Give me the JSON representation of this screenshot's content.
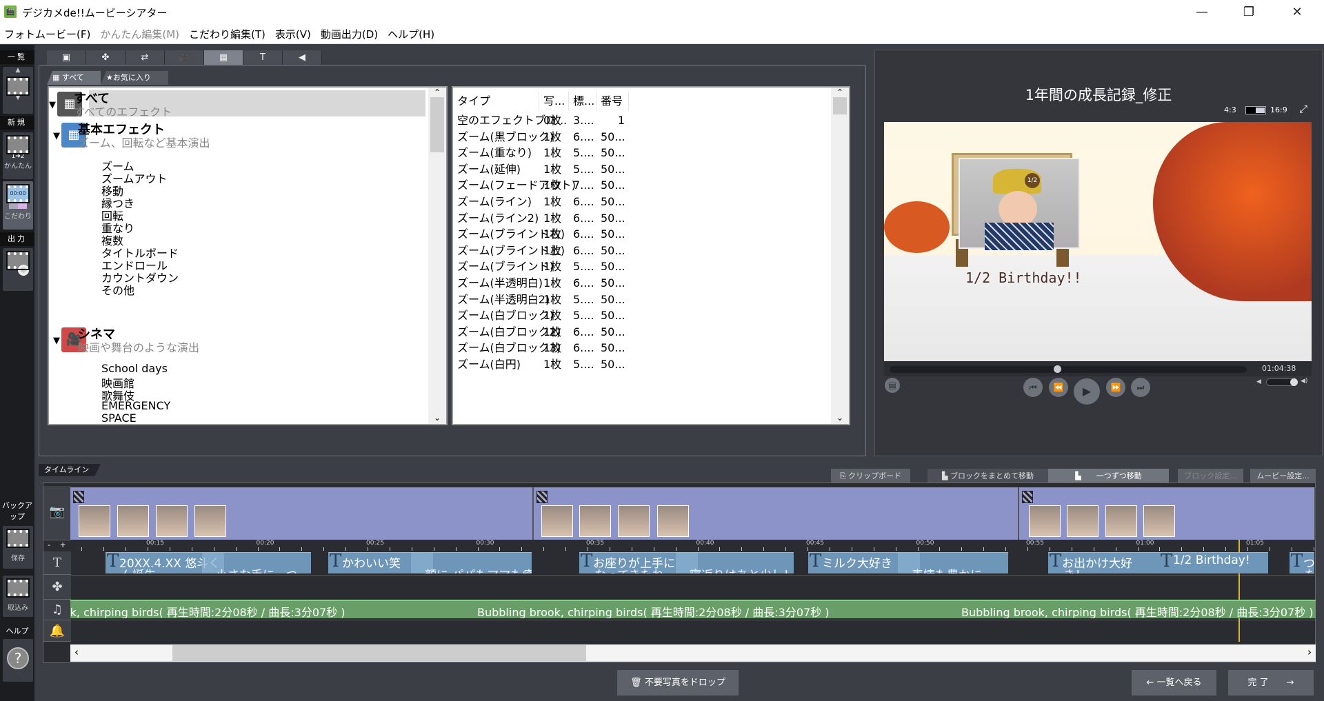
{
  "window": {
    "title": "デジカメde!!ムービーシアター",
    "minimize": "—",
    "restore": "❐",
    "close": "✕"
  },
  "menu": [
    {
      "label": "フォトムービー(F)",
      "disabled": false
    },
    {
      "label": "かんたん編集(M)",
      "disabled": true
    },
    {
      "label": "こだわり編集(T)",
      "disabled": false
    },
    {
      "label": "表示(V)",
      "disabled": false
    },
    {
      "label": "動画出力(D)",
      "disabled": false
    },
    {
      "label": "ヘルプ(H)",
      "disabled": false
    }
  ],
  "sidebar": {
    "list": "一覧",
    "new": "新規",
    "easy": "かんたん",
    "easy_badge": "1➜2",
    "detail": "こだわり",
    "detail_time": "00:00",
    "output": "出力",
    "backup": "バックアップ",
    "save": "保存",
    "import": "取込み",
    "help": "ヘルプ",
    "help_icon": "?"
  },
  "icon_tabs": [
    {
      "icon": "photo-frame-icon",
      "glyph": "▣"
    },
    {
      "icon": "clover-icon",
      "glyph": "✤"
    },
    {
      "icon": "transition-icon",
      "glyph": "⇄"
    },
    {
      "icon": "camera-icon",
      "glyph": "🎥"
    },
    {
      "icon": "effect-grid-icon",
      "glyph": "▦",
      "active": true
    },
    {
      "icon": "text-icon",
      "glyph": "T"
    },
    {
      "icon": "sound-icon",
      "glyph": "◀"
    }
  ],
  "sub_tabs": {
    "all": "すべて",
    "favorites": "★お気に入り"
  },
  "tree": {
    "categories": [
      {
        "name": "すべて",
        "desc": "すべてのエフェクト",
        "color": "#555555",
        "glyph": "▦",
        "children": []
      },
      {
        "name": "基本エフェクト",
        "desc": "ズーム、回転など基本演出",
        "color": "#4a86c8",
        "glyph": "▦",
        "children": [
          "ズーム",
          "ズームアウト",
          "移動",
          "縁つき",
          "回転",
          "重なり",
          "複数",
          "タイトルボード",
          "エンドロール",
          "カウントダウン",
          "その他"
        ]
      },
      {
        "name": "シネマ",
        "desc": "映画や舞台のような演出",
        "color": "#d04848",
        "glyph": "🎥",
        "children": [
          "School days",
          "映画館",
          "歌舞伎",
          "EMERGENCY",
          "SPACE"
        ]
      }
    ]
  },
  "table": {
    "headers": [
      "タイプ",
      "写...",
      "標...",
      "番号"
    ],
    "rows": [
      [
        "空のエフェクトブロ...",
        "0枚",
        "3....",
        "1"
      ],
      [
        "ズーム(黒ブロック)",
        "1枚",
        "6....",
        "50..."
      ],
      [
        "ズーム(重なり)",
        "1枚",
        "5....",
        "50..."
      ],
      [
        "ズーム(延伸)",
        "1枚",
        "5....",
        "50..."
      ],
      [
        "ズーム(フェードアウト)",
        "1枚",
        "7....",
        "50..."
      ],
      [
        "ズーム(ライン)",
        "1枚",
        "6....",
        "50..."
      ],
      [
        "ズーム(ライン2)",
        "1枚",
        "6....",
        "50..."
      ],
      [
        "ズーム(ブラインド右)",
        "1枚",
        "6....",
        "50..."
      ],
      [
        "ズーム(ブラインド上)",
        "1枚",
        "6....",
        "50..."
      ],
      [
        "ズーム(ブラインド)",
        "1枚",
        "5....",
        "50..."
      ],
      [
        "ズーム(半透明白)",
        "1枚",
        "6....",
        "50..."
      ],
      [
        "ズーム(半透明白2)",
        "1枚",
        "5....",
        "50..."
      ],
      [
        "ズーム(白ブロック)",
        "1枚",
        "5....",
        "50..."
      ],
      [
        "ズーム(白ブロック2)",
        "1枚",
        "6....",
        "50..."
      ],
      [
        "ズーム(白ブロック3)",
        "1枚",
        "6....",
        "50..."
      ],
      [
        "ズーム(白円)",
        "1枚",
        "5....",
        "50..."
      ]
    ]
  },
  "preview": {
    "title": "1年間の成長記録_修正",
    "ratio_4_3": "4:3",
    "ratio_16_9": "16:9",
    "ratio_selected": "16:9",
    "video_caption": "1/2 Birthday!!",
    "hat_label": "1/2",
    "time": "01:04:38",
    "seek_fraction": 0.47,
    "volume_fraction": 0.9
  },
  "timeline": {
    "tab": "タイムライン",
    "buttons": {
      "clipboard": "クリップボード",
      "move_block": "ブロックをまとめて移動",
      "move_one": "一つずつ移動",
      "block_settings": "ブロック設定...",
      "movie_settings": "ムービー設定..."
    },
    "zoom_out": "-",
    "zoom_in": "+",
    "ruler": [
      "00:15",
      "00:20",
      "00:25",
      "00:30",
      "00:35",
      "00:40",
      "00:45",
      "00:50",
      "00:55",
      "01:00",
      "01:05"
    ],
    "blocks": [
      {
        "photos": 4
      },
      {
        "photos": 4
      },
      {
        "photos": 4
      }
    ],
    "text_clips": [
      {
        "a": "20XX.4.XX  悠斗く",
        "a2": "ん誕生",
        "b": "小さな手に、つ..."
      },
      {
        "a": "かわいい笑",
        "a2": "",
        "b": "顔に パパもママも癒さ..."
      },
      {
        "a": "お座りが上手に",
        "a2": "なってきたね",
        "b": "寝返りはあと少し！"
      },
      {
        "a": "ミルク大好き",
        "a2": "",
        "b": "表情も豊かに..."
      },
      {
        "a": "お出かけ大好",
        "a2": "き！",
        "b": ""
      },
      {
        "a": "1/2 Birthday!",
        "a2": "",
        "b": ""
      },
      {
        "a": "つ",
        "a2": "た",
        "b": ""
      }
    ],
    "music": "Bubbling brook, chirping birds( 再生時間:2分08秒 / 曲長:3分07秒 )",
    "playhead_time": "01:04:38",
    "colors": {
      "photo_track": "#8b93c8",
      "text_clip": "#6d96b8",
      "music": "#6a9e68",
      "playhead": "#d6b43a"
    }
  },
  "bottom": {
    "drop": "不要写真をドロップ",
    "back": "一覧へ戻る",
    "done": "完 了"
  }
}
